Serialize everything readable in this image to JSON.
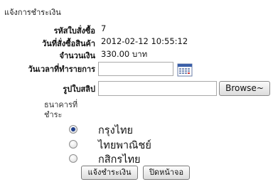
{
  "page": {
    "title": "แจ้งการชำระเงิน"
  },
  "form": {
    "order_no": {
      "label": "รหัสใบสั่งซื้อ",
      "value": "7"
    },
    "order_date": {
      "label": "วันที่สั่งซื้อสินค้า",
      "value": "2012-02-12 10:55:12"
    },
    "amount": {
      "label": "จำนวนเงิน",
      "value": "330.00 บาท"
    },
    "transfer_datetime": {
      "label": "วันเวลาที่ทำรายการ",
      "value": "",
      "icon": "calendar-icon"
    },
    "slip_image": {
      "label": "รูปใบสลิป",
      "value": "",
      "browse_label": "Browse~"
    }
  },
  "bank": {
    "label": "ธนาคารที่ชำระ",
    "options": [
      {
        "name": "กรุงไทย",
        "selected": true
      },
      {
        "name": "ไทยพาณิชย์",
        "selected": false
      },
      {
        "name": "กสิกรไทย",
        "selected": false
      }
    ]
  },
  "buttons": {
    "submit_label": "แจ้งชำระเงิน",
    "close_label": "ปิดหน้าจอ"
  }
}
